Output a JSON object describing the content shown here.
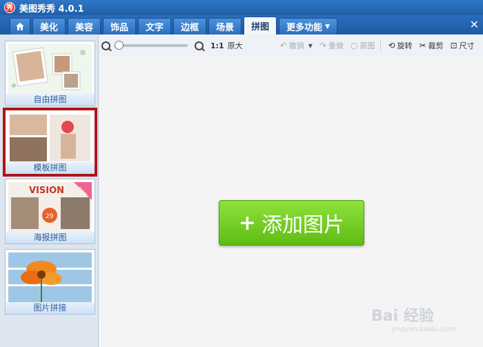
{
  "window": {
    "title": "美图秀秀 4.0.1",
    "logo_text": "秀"
  },
  "tabs": [
    {
      "label": "美化"
    },
    {
      "label": "美容"
    },
    {
      "label": "饰品"
    },
    {
      "label": "文字"
    },
    {
      "label": "边框"
    },
    {
      "label": "场景"
    },
    {
      "label": "拼图"
    },
    {
      "label": "更多功能"
    }
  ],
  "active_tab": "拼图",
  "sidebar": {
    "items": [
      {
        "label": "自由拼图"
      },
      {
        "label": "模板拼图"
      },
      {
        "label": "海报拼图",
        "badge": "new"
      },
      {
        "label": "图片拼接"
      }
    ],
    "selected": "模板拼图"
  },
  "toolbar": {
    "zoom_ratio": "1:1",
    "original_size": "原大",
    "undo": "撤销",
    "redo": "重做",
    "original_image": "原图",
    "rotate": "旋转",
    "crop": "裁剪",
    "size": "尺寸",
    "zoom_level": 0
  },
  "canvas": {
    "add_button_label": "添加图片",
    "plus": "+"
  },
  "watermark": {
    "line1": "Bai 经验",
    "line2": "jingyan.baidu.com"
  },
  "colors": {
    "accent_blue": "#2a6dbd",
    "add_green": "#6fcb1d",
    "selected_border": "#b01515"
  }
}
